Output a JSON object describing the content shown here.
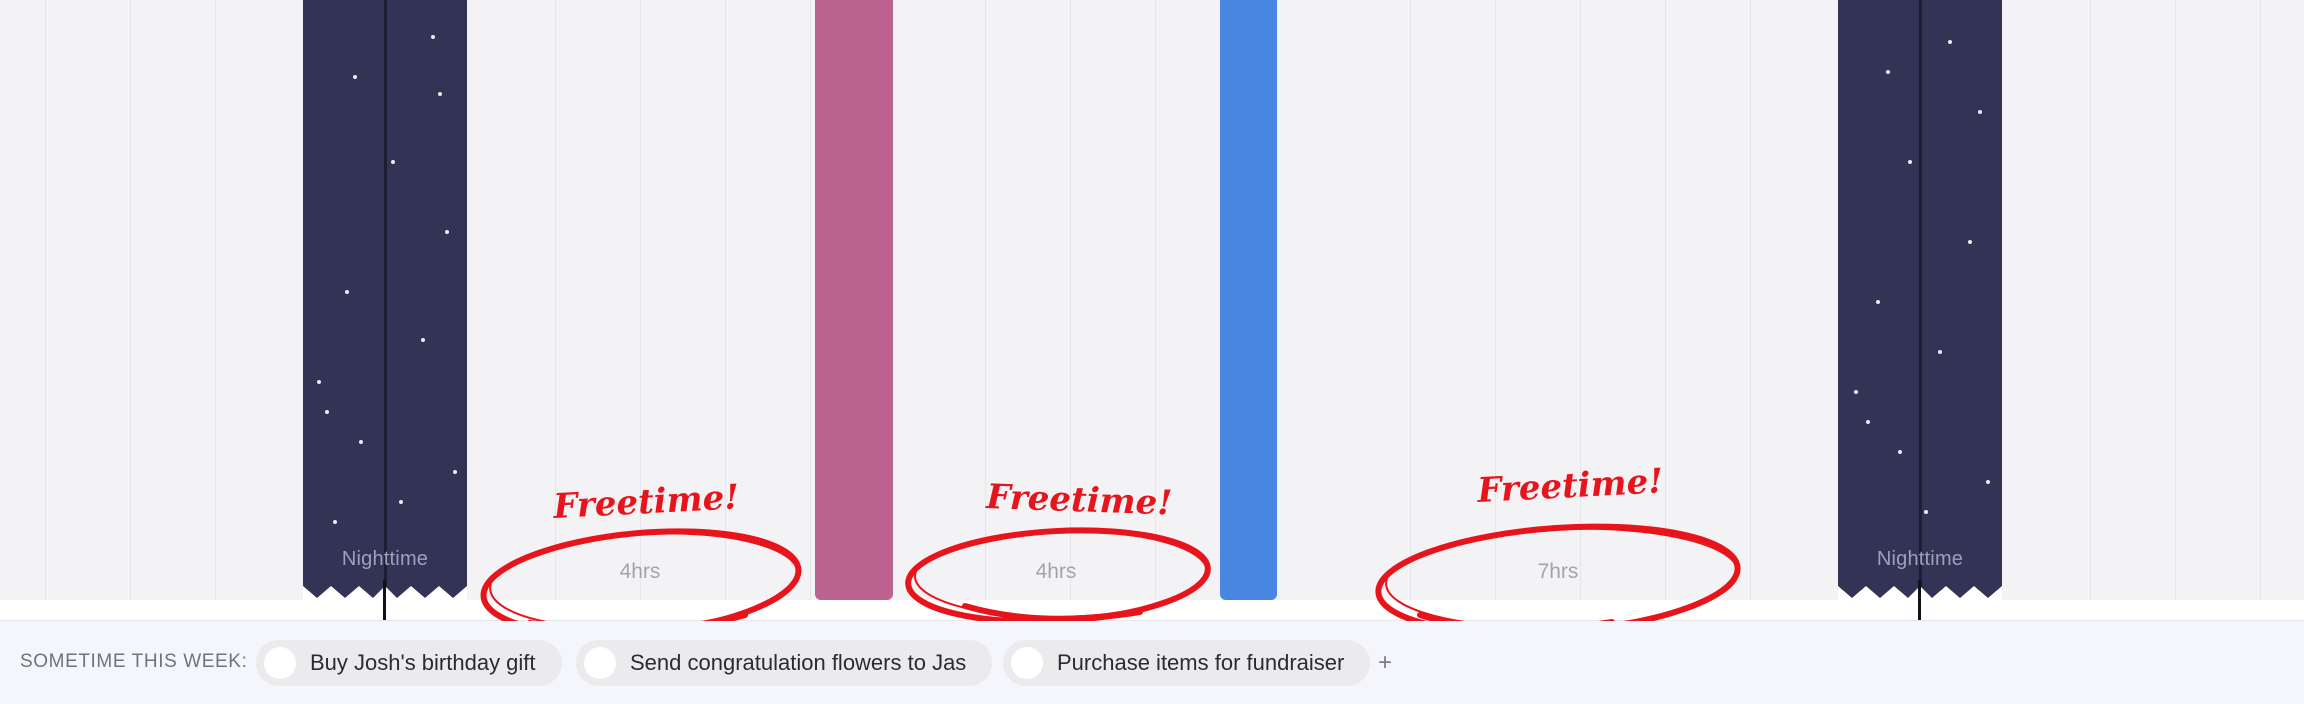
{
  "timeline": {
    "night_label": "Nighttime",
    "free_blocks": [
      {
        "duration": "4hrs",
        "annotation": "Freetime!"
      },
      {
        "duration": "4hrs",
        "annotation": "Freetime!"
      },
      {
        "duration": "7hrs",
        "annotation": "Freetime!"
      }
    ],
    "colors": {
      "night": "#333355",
      "event_pink": "#bb638e",
      "event_blue": "#4886e2",
      "annotation_red": "#e8141c"
    }
  },
  "sometime": {
    "title": "SOMETIME THIS WEEK:",
    "tasks": [
      {
        "label": "Buy Josh's birthday gift",
        "icon": "checkbox-circle-icon"
      },
      {
        "label": "Send congratulation flowers to Jas",
        "icon": "checkbox-circle-icon"
      },
      {
        "label": "Purchase items for fundraiser",
        "icon": "checkbox-circle-icon"
      }
    ],
    "add_label": "+"
  }
}
